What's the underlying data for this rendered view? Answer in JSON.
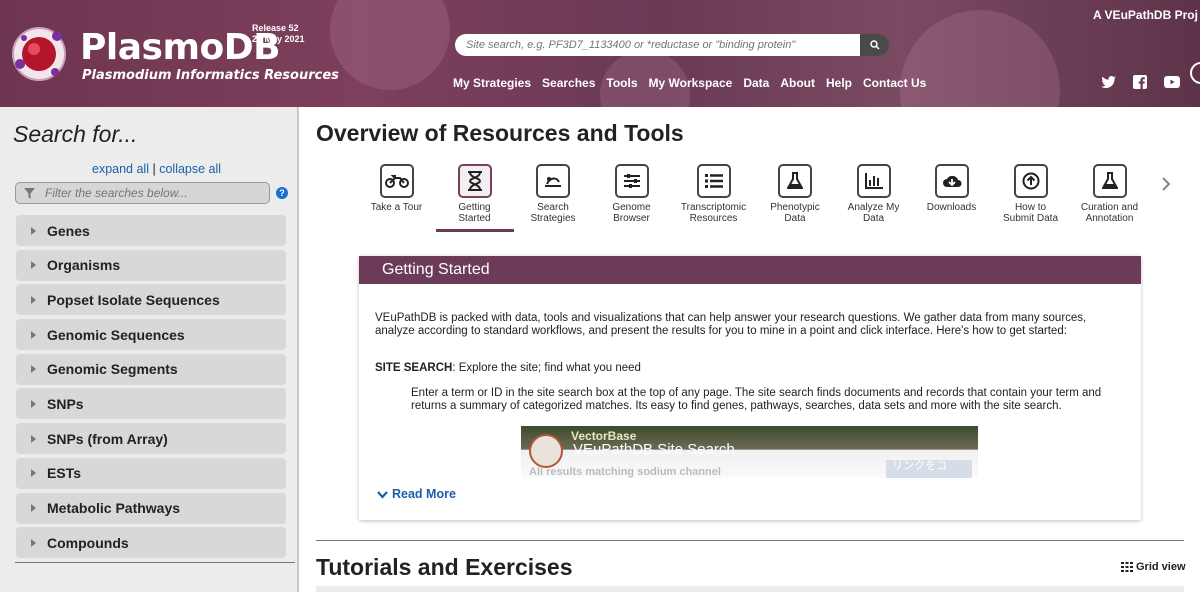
{
  "header": {
    "brand": "PlasmoDB",
    "tagline": "Plasmodium Informatics Resources",
    "release_line1": "Release 52",
    "release_line2": "20 May 2021",
    "search_placeholder": "Site search, e.g. PF3D7_1133400 or *reductase or \"binding protein\"",
    "nav": [
      "My Strategies",
      "Searches",
      "Tools",
      "My Workspace",
      "Data",
      "About",
      "Help",
      "Contact Us"
    ],
    "veupath": "A VEuPathDB Proj"
  },
  "sidebar": {
    "title": "Search for...",
    "expand_all": "expand all",
    "separator": "|",
    "collapse_all": "collapse all",
    "filter_placeholder": "Filter the searches below...",
    "help": "?",
    "items": [
      "Genes",
      "Organisms",
      "Popset Isolate Sequences",
      "Genomic Sequences",
      "Genomic Segments",
      "SNPs",
      "SNPs (from Array)",
      "ESTs",
      "Metabolic Pathways",
      "Compounds"
    ]
  },
  "main": {
    "title": "Overview of Resources and Tools",
    "tools": [
      {
        "line1": "Take a Tour",
        "line2": "",
        "icon": "motorbike-icon"
      },
      {
        "line1": "Getting",
        "line2": "Started",
        "icon": "hourglass-icon",
        "active": true
      },
      {
        "line1": "Search",
        "line2": "Strategies",
        "icon": "strategy-icon"
      },
      {
        "line1": "Genome",
        "line2": "Browser",
        "icon": "sliders-icon"
      },
      {
        "line1": "Transcriptomic",
        "line2": "Resources",
        "icon": "list-icon"
      },
      {
        "line1": "Phenotypic",
        "line2": "Data",
        "icon": "flask-icon"
      },
      {
        "line1": "Analyze My",
        "line2": "Data",
        "icon": "bar-chart-icon"
      },
      {
        "line1": "Downloads",
        "line2": "",
        "icon": "cloud-download-icon"
      },
      {
        "line1": "How to",
        "line2": "Submit Data",
        "icon": "upload-icon"
      },
      {
        "line1": "Curation and",
        "line2": "Annotation",
        "icon": "flask-icon"
      }
    ],
    "panel": {
      "title": "Getting Started",
      "p1": "VEuPathDB is packed with data, tools and visualizations that can help answer your research questions. We gather data from many sources, analyze according to standard workflows, and present the results for you to mine in a point and click interface. Here's how to get started:",
      "site_search_label": "SITE SEARCH",
      "site_search_text": ": Explore the site; find what you need",
      "p2": "Enter a term or ID in the site search box at the top of any page. The site search finds documents and records that contain your term and returns a summary of categorized matches. Its easy to find genes, pathways, searches, data sets and more with the site search.",
      "video_brand": "VectorBase",
      "video_title": "VEuPathDB Site Search",
      "video_caption_prefix": "All results matching ",
      "video_caption_term": "sodium channel",
      "video_button": "リンクをコ",
      "read_more": "Read More"
    },
    "tutorials_title": "Tutorials and Exercises",
    "grid_view": "Grid view"
  }
}
